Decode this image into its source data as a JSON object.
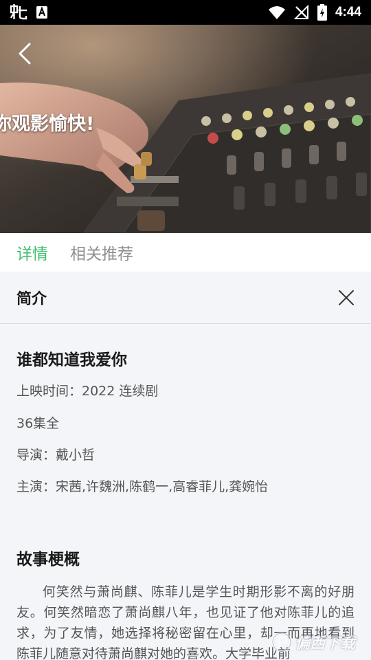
{
  "status_bar": {
    "time": "4:44",
    "left_icons": [
      "bug-icon",
      "font-a-icon"
    ],
    "right_icons": [
      "wifi-icon",
      "no-signal-icon",
      "battery-charging-icon"
    ]
  },
  "player": {
    "caption": "你观影愉快!"
  },
  "tabs": [
    {
      "label": "详情",
      "active": true
    },
    {
      "label": "相关推荐",
      "active": false
    }
  ],
  "intro_panel": {
    "title": "简介",
    "show_title": "谁都知道我爱你",
    "release": "上映时间：2022  连续剧",
    "episodes": "36集全",
    "director": "导演：戴小哲",
    "cast": "主演：宋茜,许魏洲,陈鹤一,高睿菲儿,龚婉怡",
    "synopsis_title": "故事梗概",
    "synopsis": "何笑然与萧尚麒、陈菲儿是学生时期形影不离的好朋友。何笑然暗恋了萧尚麒八年，也见证了他对陈菲儿的追求，为了友情，她选择将秘密留在心里，却一而再地看到陈菲儿随意对待萧尚麒对她的喜欢。大学毕业前"
  },
  "watermark": {
    "text": "偏西下载"
  },
  "colors": {
    "accent": "#3ec06e",
    "panel_bg": "#f4f5f9",
    "status_bar": "#000000"
  }
}
